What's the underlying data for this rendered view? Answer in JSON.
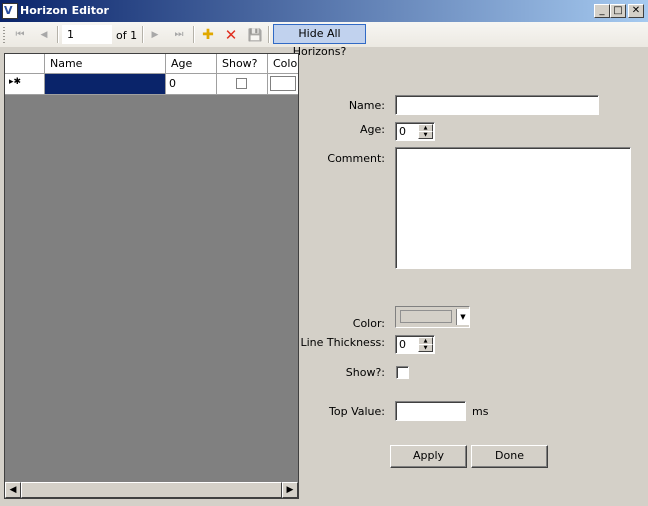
{
  "window": {
    "title": "Horizon Editor",
    "minimize": "_",
    "maximize": "□",
    "close": "✕"
  },
  "toolbar": {
    "first": "⏮",
    "prev": "◀",
    "position": "1",
    "of_label": "of 1",
    "next": "▶",
    "last": "⏭",
    "add": "✚",
    "delete": "✕",
    "save": "💾",
    "hide_all": "Hide All Horizons?"
  },
  "grid": {
    "columns": [
      "Name",
      "Age",
      "Show?",
      "Color"
    ],
    "row_indicator": "▸✱",
    "row": {
      "name": "",
      "age": "0"
    }
  },
  "form": {
    "name_label": "Name:",
    "name_value": "",
    "age_label": "Age:",
    "age_value": "0",
    "comment_label": "Comment:",
    "comment_value": "",
    "color_label": "Color:",
    "thickness_label": "Line Thickness:",
    "thickness_value": "0",
    "show_label": "Show?:",
    "top_value_label": "Top Value:",
    "top_value": "",
    "top_value_unit": "ms",
    "apply": "Apply",
    "done": "Done"
  },
  "colors": {
    "selection": "#0a246a",
    "grid_bg": "#808080",
    "form_bg": "#d4d0c8"
  }
}
